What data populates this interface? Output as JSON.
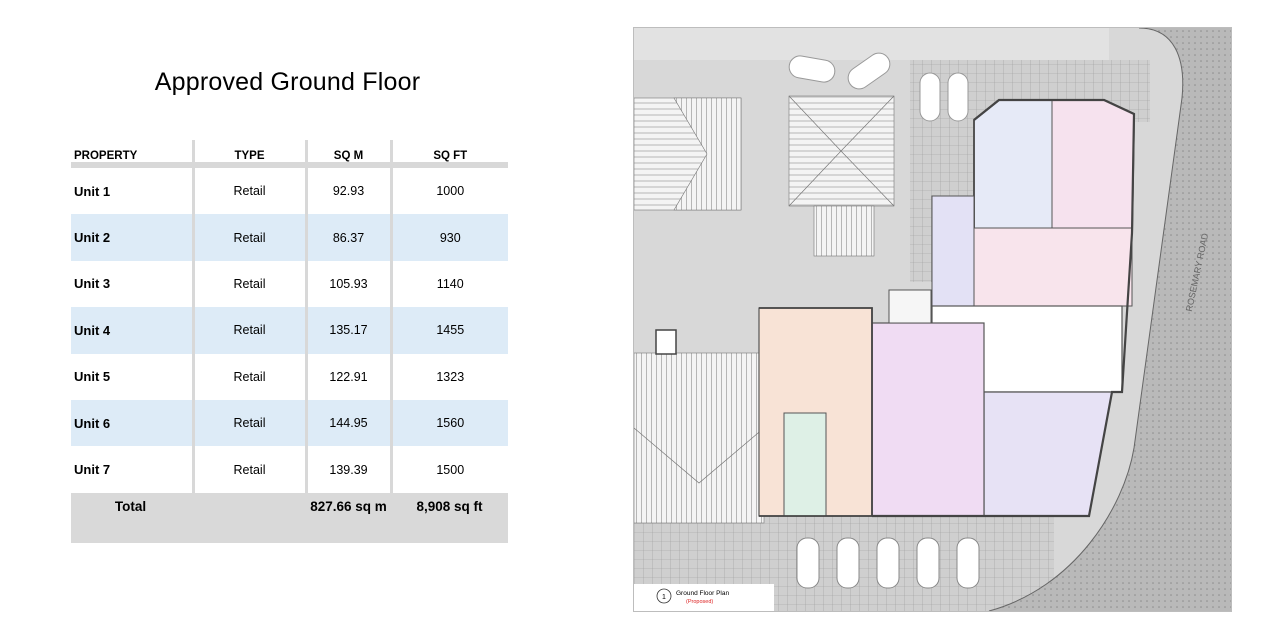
{
  "page": {
    "title": "Approved Ground Floor"
  },
  "table": {
    "headers": [
      "PROPERTY",
      "TYPE",
      "SQ M",
      "SQ FT"
    ],
    "rows": [
      {
        "property": "Unit 1",
        "type": "Retail",
        "sqm": "92.93",
        "sqft": "1000"
      },
      {
        "property": "Unit 2",
        "type": "Retail",
        "sqm": "86.37",
        "sqft": "930"
      },
      {
        "property": "Unit 3",
        "type": "Retail",
        "sqm": "105.93",
        "sqft": "1140"
      },
      {
        "property": "Unit 4",
        "type": "Retail",
        "sqm": "135.17",
        "sqft": "1455"
      },
      {
        "property": "Unit 5",
        "type": "Retail",
        "sqm": "122.91",
        "sqft": "1323"
      },
      {
        "property": "Unit 6",
        "type": "Retail",
        "sqm": "144.95",
        "sqft": "1560"
      },
      {
        "property": "Unit 7",
        "type": "Retail",
        "sqm": "139.39",
        "sqft": "1500"
      }
    ],
    "total": {
      "label": "Total",
      "sqm": "827.66 sq m",
      "sqft": "8,908 sq ft"
    }
  },
  "plan": {
    "road_label": "ROSEMARY ROAD",
    "caption_number": "1",
    "caption_title": "Ground Floor Plan",
    "caption_subtitle": "(Proposed)",
    "colors": {
      "unit_blue": "#e6eaf7",
      "unit_pink": "#f6e2ee",
      "unit_lilac": "#f0dcf3",
      "unit_peach": "#f8e3d6",
      "unit_mint": "#def0e6",
      "unit_violet": "#e3e1f5",
      "paving": "#cdcdcd",
      "ground": "#d8d8d8"
    }
  }
}
